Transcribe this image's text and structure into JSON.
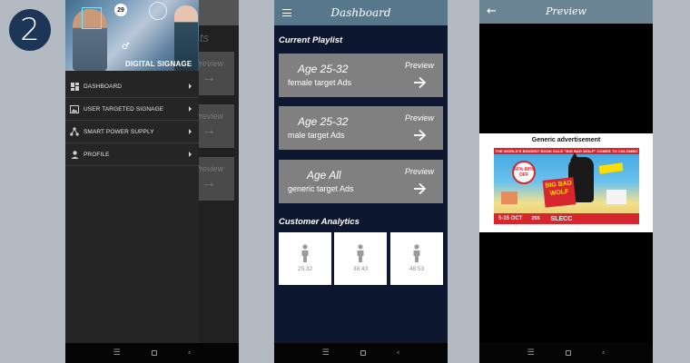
{
  "step_number": "2",
  "phone1": {
    "background_title": "ts",
    "background_cards": [
      {
        "preview_label": "Preview"
      },
      {
        "preview_label": "Preview"
      },
      {
        "preview_label": "Preview"
      }
    ],
    "drawer": {
      "hero_badge_count": "29",
      "hero_title": "DIGITAL SIGNAGE",
      "menu_items": [
        {
          "label": "DASHBOARD",
          "icon": "dashboard-icon"
        },
        {
          "label": "USER TARGETED SIGNAGE",
          "icon": "image-icon"
        },
        {
          "label": "SMART POWER SUPPLY",
          "icon": "network-icon"
        },
        {
          "label": "PROFILE",
          "icon": "person-icon"
        }
      ]
    }
  },
  "phone2": {
    "header_title": "Dashboard",
    "playlist_section_title": "Current Playlist",
    "playlists": [
      {
        "age": "Age 25-32",
        "subtitle": "female target Ads",
        "preview_label": "Preview"
      },
      {
        "age": "Age 25-32",
        "subtitle": "male target Ads",
        "preview_label": "Preview"
      },
      {
        "age": "Age All",
        "subtitle": "generic target Ads",
        "preview_label": "Preview"
      }
    ],
    "analytics_section_title": "Customer Analytics",
    "analytics": [
      {
        "range": "25:32"
      },
      {
        "range": "38:43"
      },
      {
        "range": "48:53"
      }
    ]
  },
  "phone3": {
    "header_title": "Preview",
    "ad_title": "Generic advertisement",
    "ad": {
      "top_banner": "THE WORLD'S BIGGEST BOOK SALE \"BIG BAD WOLF\" COMES TO COLOMBO",
      "sale_badge": "60%-80% OFF",
      "brand": "BIG BAD WOLF",
      "dates": "5-15 OCT",
      "hours": "255",
      "venue": "SLECC"
    }
  },
  "colors": {
    "page_background": "#b4bac2",
    "step_badge": "#1d3557",
    "dashboard_header": "#56788a",
    "dashboard_background": "#0d1730",
    "playlist_card": "#808080",
    "drawer_background": "#252525"
  }
}
